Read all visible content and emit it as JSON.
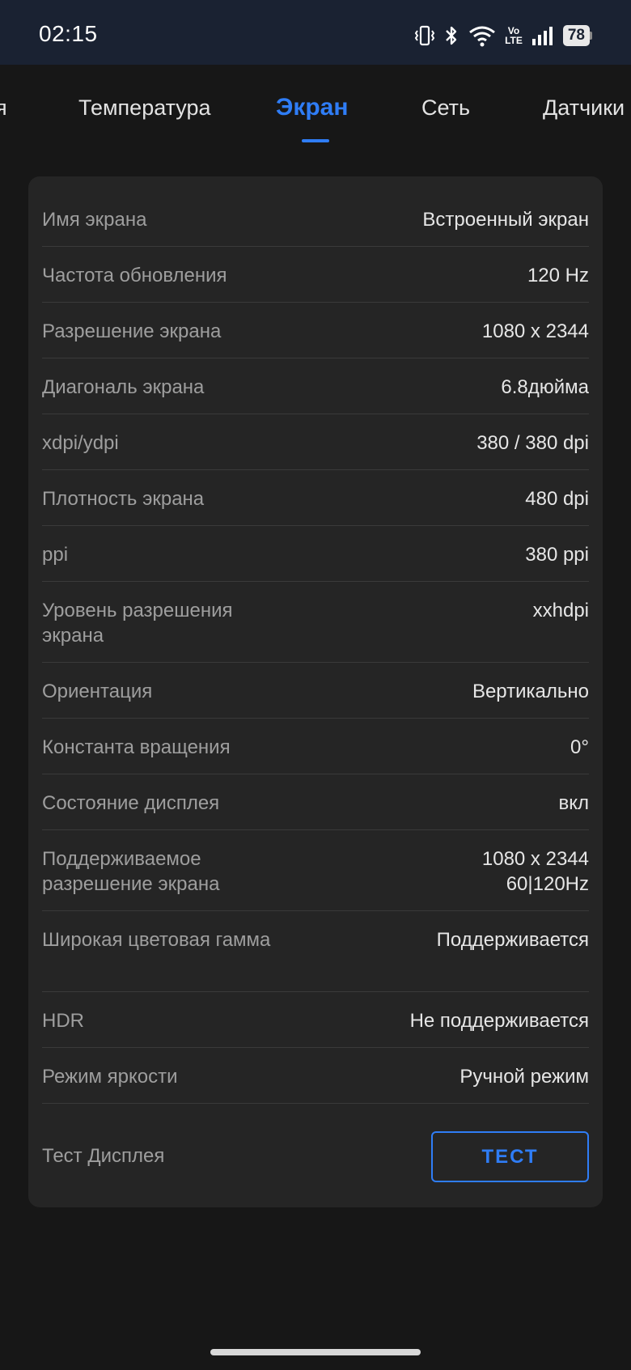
{
  "status_bar": {
    "time": "02:15",
    "volte_line1": "Vo",
    "volte_line2": "LTE",
    "battery_level": "78",
    "icons": [
      "vibrate-icon",
      "bluetooth-icon",
      "wifi-icon",
      "volte-icon",
      "signal-icon",
      "battery-icon"
    ]
  },
  "tabs": {
    "items": [
      {
        "label": "я"
      },
      {
        "label": "Температура"
      },
      {
        "label": "Экран"
      },
      {
        "label": "Сеть"
      },
      {
        "label": "Датчики"
      }
    ],
    "active_index": 2,
    "accent_color": "#2f7df6"
  },
  "screen_info": {
    "rows": [
      {
        "label": "Имя экрана",
        "value": "Встроенный экран"
      },
      {
        "label": "Частота обновления",
        "value": "120 Hz"
      },
      {
        "label": "Разрешение экрана",
        "value": "1080 x 2344"
      },
      {
        "label": "Диагональ экрана",
        "value": "6.8дюйма"
      },
      {
        "label": "xdpi/ydpi",
        "value": "380 / 380 dpi"
      },
      {
        "label": "Плотность экрана",
        "value": "480 dpi"
      },
      {
        "label": "ppi",
        "value": "380 ppi"
      },
      {
        "label": "Уровень разрешения экрана",
        "value": "xxhdpi"
      },
      {
        "label": "Ориентация",
        "value": "Вертикально"
      },
      {
        "label": "Константа вращения",
        "value": "0°"
      },
      {
        "label": "Состояние дисплея",
        "value": "вкл"
      },
      {
        "label": "Поддерживаемое разрешение экрана",
        "value": "1080 x 2344\n60|120Hz"
      },
      {
        "label": "Широкая цветовая гамма",
        "value": "Поддерживается"
      },
      {
        "label": "HDR",
        "value": "Не поддерживается"
      },
      {
        "label": "Режим яркости",
        "value": "Ручной режим"
      }
    ],
    "test": {
      "label": "Тест Дисплея",
      "button_label": "ТЕСТ"
    }
  }
}
